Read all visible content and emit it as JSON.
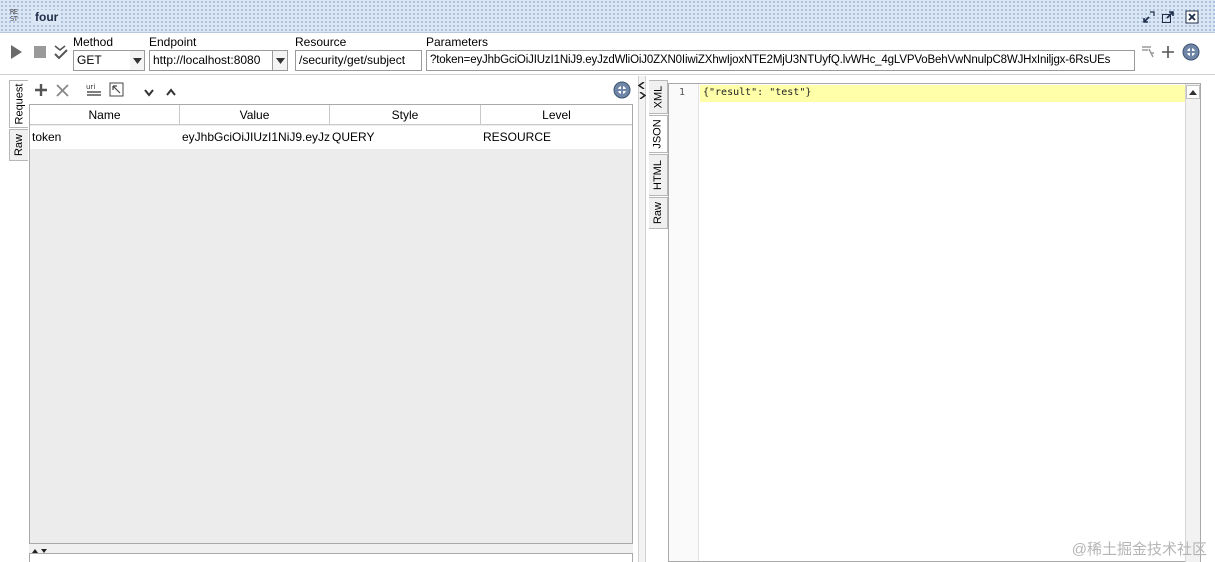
{
  "window": {
    "logo_text": "RE ST",
    "title": "four"
  },
  "toolbar": {
    "method_label": "Method",
    "method_value": "GET",
    "endpoint_label": "Endpoint",
    "endpoint_value": "http://localhost:8080",
    "resource_label": "Resource",
    "resource_value": "/security/get/subject",
    "parameters_label": "Parameters",
    "parameters_value": "?token=eyJhbGciOiJIUzI1NiJ9.eyJzdWliOiJ0ZXN0IiwiZXhwIjoxNTE2MjU3NTUyfQ.lvWHc_4gLVPVoBehVwNnulpC8WJHxIniljgx-6RsUEs"
  },
  "request_tabs": [
    "Request",
    "Raw"
  ],
  "param_toolbar": {
    "icons": [
      "plus-icon",
      "delete-icon",
      "url-template-icon",
      "reorder-icon",
      "move-down-icon",
      "move-up-icon",
      "help-icon"
    ]
  },
  "params_table": {
    "columns": [
      "Name",
      "Value",
      "Style",
      "Level"
    ],
    "rows": [
      {
        "name": "token",
        "value": "eyJhbGciOiJIUzI1NiJ9.eyJz...",
        "style": "QUERY",
        "level": "RESOURCE"
      }
    ]
  },
  "response_tabs": [
    "XML",
    "JSON",
    "HTML",
    "Raw"
  ],
  "response": {
    "line_number": "1",
    "content": "{\"result\": \"test\"}"
  },
  "watermark": "@稀土掘金技术社区"
}
